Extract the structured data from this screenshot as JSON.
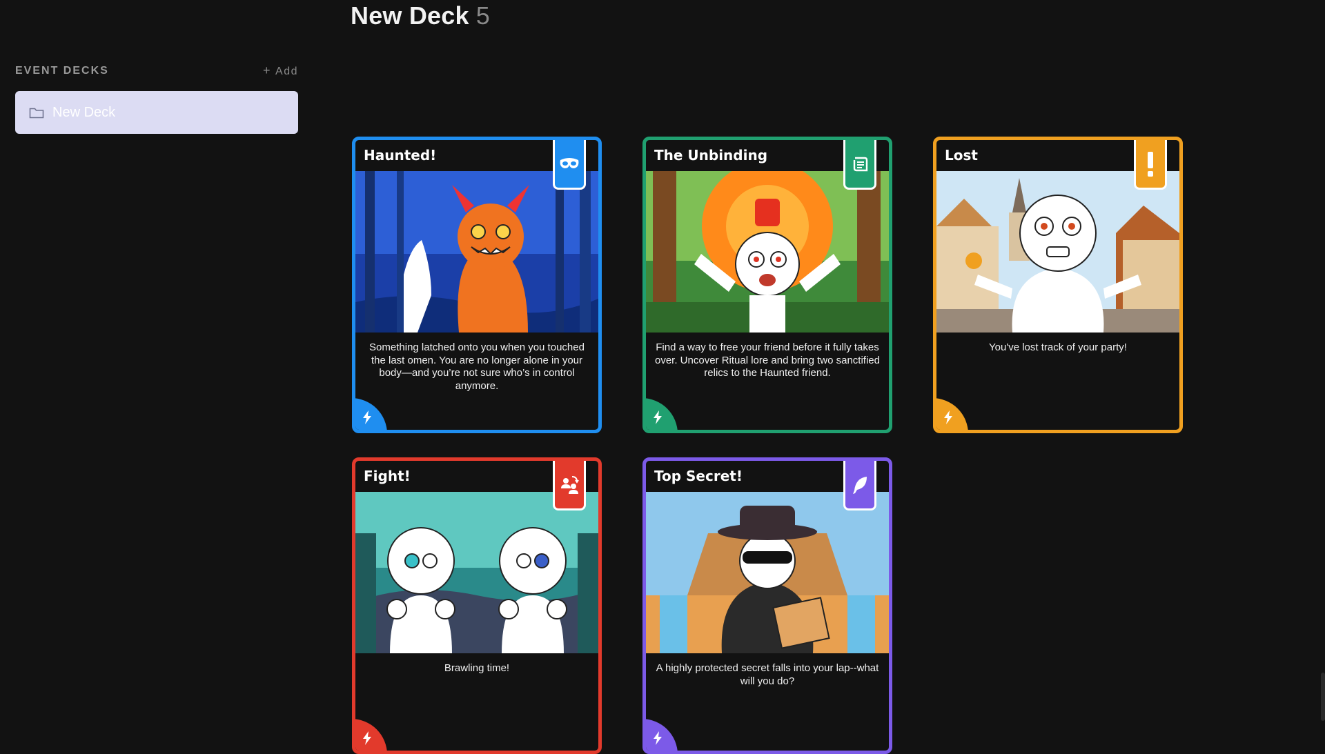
{
  "header": {
    "title": "New Deck",
    "count": "5"
  },
  "sidebar": {
    "section_title": "EVENT DECKS",
    "add_label": "Add",
    "decks": [
      {
        "label": "New Deck",
        "icon": "folder-icon"
      }
    ]
  },
  "cards": [
    {
      "title": "Haunted!",
      "badge_icon": "mask-icon",
      "color": "#1f8ef0",
      "text": "Something latched onto you when you touched the last omen. You are no longer alone in your body—and you’re not sure who’s in control anymore."
    },
    {
      "title": "The Unbinding",
      "badge_icon": "scroll-icon",
      "color": "#20a070",
      "text": "Find a way to free your friend before it fully takes over. Uncover Ritual lore and bring two sanctified relics to the Haunted friend."
    },
    {
      "title": "Lost",
      "badge_icon": "exclamation-icon",
      "color": "#f0a020",
      "text": "You've lost track of your party!"
    },
    {
      "title": "Fight!",
      "badge_icon": "swap-people-icon",
      "color": "#e23a2c",
      "text": "Brawling time!"
    },
    {
      "title": "Top Secret!",
      "badge_icon": "feather-icon",
      "color": "#7c5ae8",
      "text": "A highly protected secret falls into your lap--what will you do?"
    }
  ]
}
